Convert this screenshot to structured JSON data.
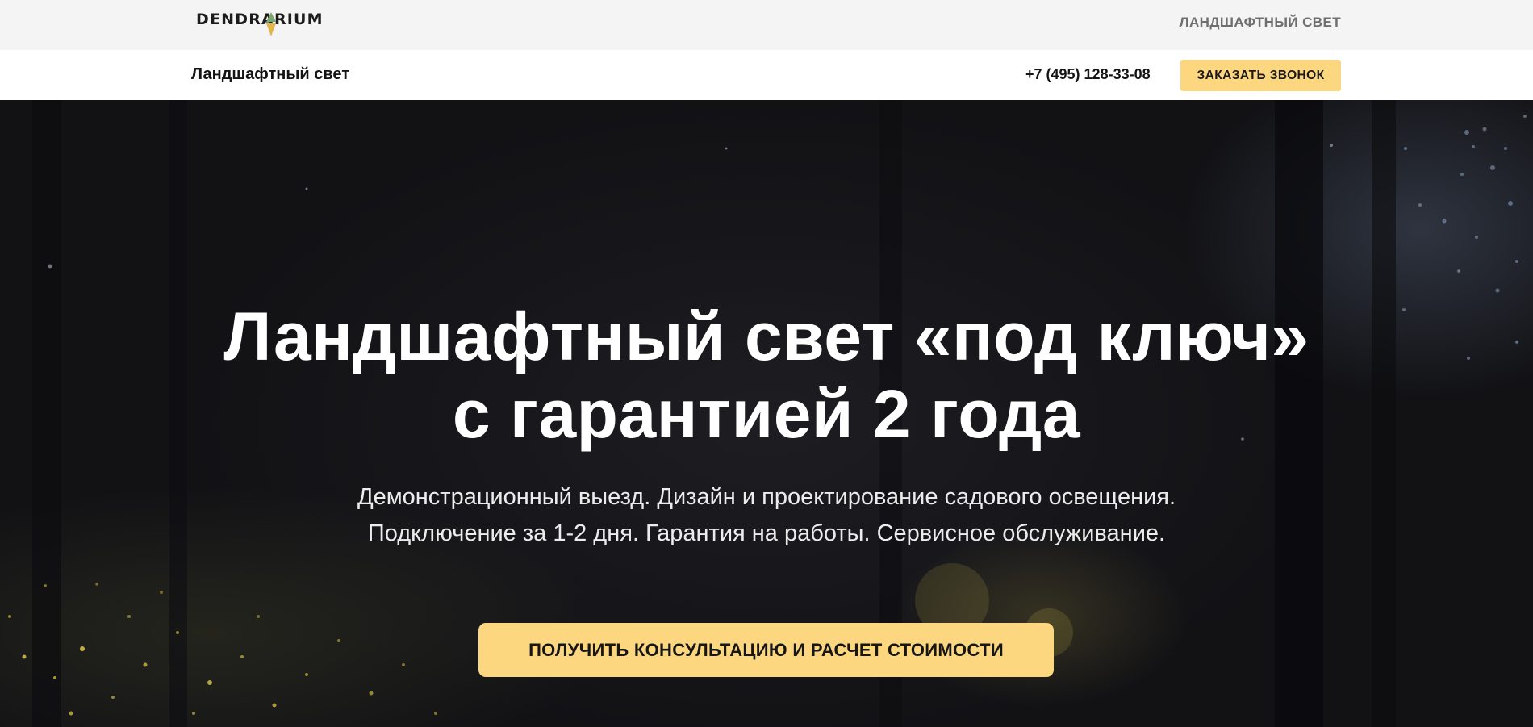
{
  "topbar": {
    "logo_text": "DENDRARIUM",
    "link_label": "ЛАНДШАФТНЫЙ СВЕТ"
  },
  "navbar": {
    "title": "Ландшафтный свет",
    "phone": "+7 (495) 128-33-08",
    "callback_label": "ЗАКАЗАТЬ ЗВОНОК"
  },
  "hero": {
    "title": "Ландшафтный свет «под ключ» с гарантией 2 года",
    "subtitle": "Демонстрационный выезд. Дизайн и проектирование садового освещения. Подключение за 1-2 дня. Гарантия на работы. Сервисное обслуживание.",
    "cta_label": "ПОЛУЧИТЬ КОНСУЛЬТАЦИЮ И РАСЧЕТ СТОИМОСТИ"
  },
  "colors": {
    "accent": "#fdd77f",
    "topbar_bg": "#f4f4f4",
    "navbar_bg": "#ffffff",
    "hero_bg": "#16161a",
    "logo_mark_green": "#7aa66f",
    "logo_mark_gold": "#e2b64a"
  }
}
